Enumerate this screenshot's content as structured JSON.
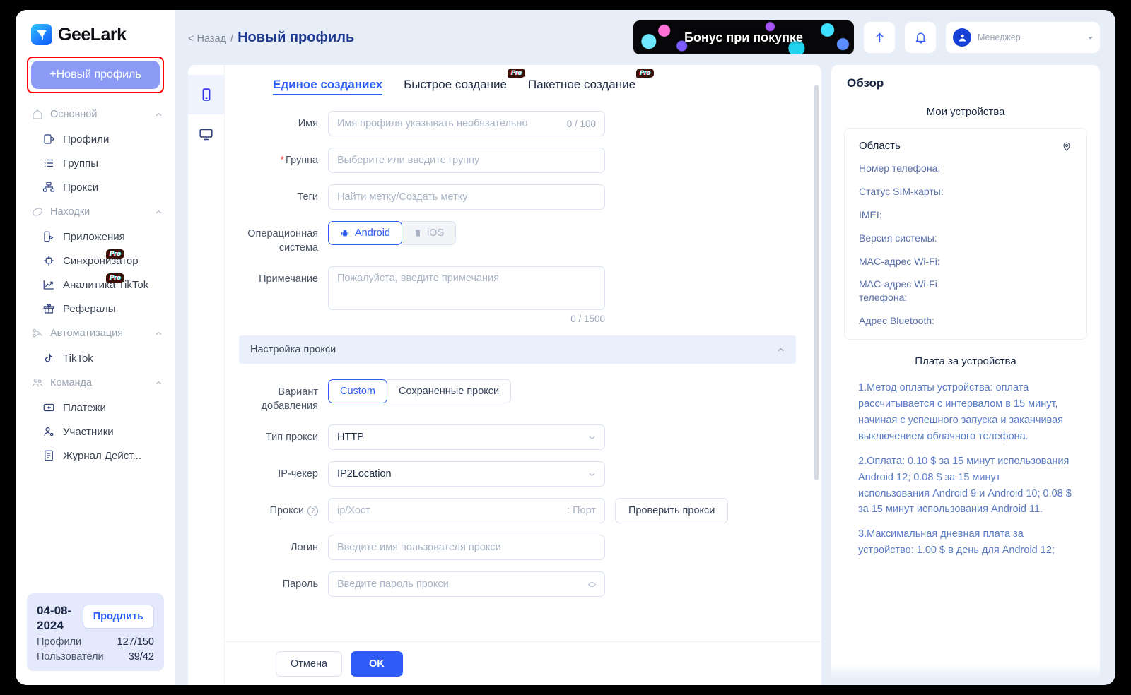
{
  "brand": {
    "name": "GeeLark"
  },
  "sidebar": {
    "new_profile_button": "+Новый профиль",
    "groups": [
      {
        "label": "Основной",
        "icon": "home-icon",
        "items": [
          {
            "label": "Профили",
            "icon": "profiles-icon",
            "pro": false
          },
          {
            "label": "Группы",
            "icon": "groups-icon",
            "pro": false
          },
          {
            "label": "Прокси",
            "icon": "proxy-icon",
            "pro": false
          }
        ]
      },
      {
        "label": "Находки",
        "icon": "discover-icon",
        "items": [
          {
            "label": "Приложения",
            "icon": "apps-icon",
            "pro": false
          },
          {
            "label": "Синхронизатор",
            "icon": "sync-icon",
            "pro": true,
            "pro_label": "Pro"
          },
          {
            "label": "Аналитика TikTok",
            "icon": "analytics-icon",
            "pro": true,
            "pro_label": "Pro"
          },
          {
            "label": "Рефералы",
            "icon": "gift-icon",
            "pro": false
          }
        ]
      },
      {
        "label": "Автоматизация",
        "icon": "automation-icon",
        "items": [
          {
            "label": "TikTok",
            "icon": "tiktok-icon",
            "pro": false
          }
        ]
      },
      {
        "label": "Команда",
        "icon": "team-icon",
        "items": [
          {
            "label": "Платежи",
            "icon": "payments-icon",
            "pro": false
          },
          {
            "label": "Участники",
            "icon": "members-icon",
            "pro": false
          },
          {
            "label": "Журнал Дейст...",
            "icon": "log-icon",
            "pro": false
          }
        ]
      }
    ],
    "subscription": {
      "date": "04-08-2024",
      "renew_label": "Продлить",
      "rows": [
        {
          "label": "Профили",
          "value": "127/150"
        },
        {
          "label": "Пользователи",
          "value": "39/42"
        }
      ]
    }
  },
  "topbar": {
    "back_label": "< Назад",
    "separator": "/",
    "title": "Новый профиль",
    "promo_text": "Бонус при покупке",
    "upload_icon": "arrow-up-icon",
    "bell_icon": "bell-icon",
    "user_role": "Менеджер"
  },
  "form": {
    "rail": [
      {
        "icon": "phone-icon",
        "active": true
      },
      {
        "icon": "desktop-icon",
        "active": false
      }
    ],
    "tabs": [
      {
        "label": "Единое созданиех",
        "active": true,
        "pro": false
      },
      {
        "label": "Быстрое создание",
        "active": false,
        "pro": true,
        "pro_label": "Pro"
      },
      {
        "label": "Пакетное создание",
        "active": false,
        "pro": true,
        "pro_label": "Pro"
      }
    ],
    "name": {
      "label": "Имя",
      "placeholder": "Имя профиля указывать необязательно",
      "counter": "0 / 100",
      "value": ""
    },
    "group": {
      "label": "Группа",
      "required": true,
      "placeholder": "Выберите или введите группу",
      "value": ""
    },
    "tags": {
      "label": "Теги",
      "placeholder": "Найти метку/Создать метку",
      "value": ""
    },
    "os": {
      "label": "Операционная система",
      "options": [
        {
          "label": "Android",
          "icon": "android-icon",
          "active": true
        },
        {
          "label": "iOS",
          "icon": "apple-icon",
          "active": false
        }
      ]
    },
    "note": {
      "label": "Примечание",
      "placeholder": "Пожалуйста, введите примечания",
      "counter": "0 / 1500",
      "value": ""
    },
    "proxy_section": {
      "title": "Настройка прокси",
      "collapse_icon": "chevron-up-icon"
    },
    "add_variant": {
      "label": "Вариант добавления",
      "options": [
        {
          "label": "Custom",
          "active": true
        },
        {
          "label": "Сохраненные прокси",
          "active": false
        }
      ]
    },
    "proxy_type": {
      "label": "Тип прокси",
      "value": "HTTP",
      "caret_icon": "chevron-down-icon"
    },
    "ip_checker": {
      "label": "IP-чекер",
      "value": "IP2Location",
      "caret_icon": "chevron-down-icon"
    },
    "proxy": {
      "label": "Прокси",
      "help_icon": "question-icon",
      "host_placeholder": "ip/Хост",
      "port_placeholder": ": Порт",
      "check_button": "Проверить прокси"
    },
    "login": {
      "label": "Логин",
      "placeholder": "Введите имя пользователя прокси",
      "value": ""
    },
    "password": {
      "label": "Пароль",
      "placeholder": "Введите пароль прокси",
      "value": ""
    },
    "footer": {
      "cancel": "Отмена",
      "ok": "OK"
    }
  },
  "side_panel": {
    "title": "Обзор",
    "devices_section_title": "Мои устройства",
    "device": {
      "area_label": "Область",
      "location_icon": "location-pin-icon",
      "fields": [
        "Номер телефона:",
        "Статус SIM-карты:",
        "IMEI:",
        "Версия системы:",
        "MAC-адрес Wi-Fi:",
        "MAC-адрес Wi-Fi телефона:",
        "Адрес Bluetooth:"
      ]
    },
    "billing_section_title": "Плата за устройства",
    "billing_paragraphs": [
      "1.Метод оплаты устройства: оплата рассчитывается с интервалом в 15 минут, начиная с успешного запуска и заканчивая выключением облачного телефона.",
      "2.Оплата: 0.10 $ за 15 минут использования Android 12; 0.08 $ за 15 минут использования Android 9 и Android 10; 0.08 $ за 15 минут использования Android 11.",
      "3.Максимальная дневная плата за устройство: 1.00 $ в день для Android 12;"
    ]
  },
  "colors": {
    "accent": "#2f5cf6",
    "brand_purple": "#8b9bf5",
    "highlight_red": "#ff0000",
    "page_bg": "#e8eef8"
  }
}
